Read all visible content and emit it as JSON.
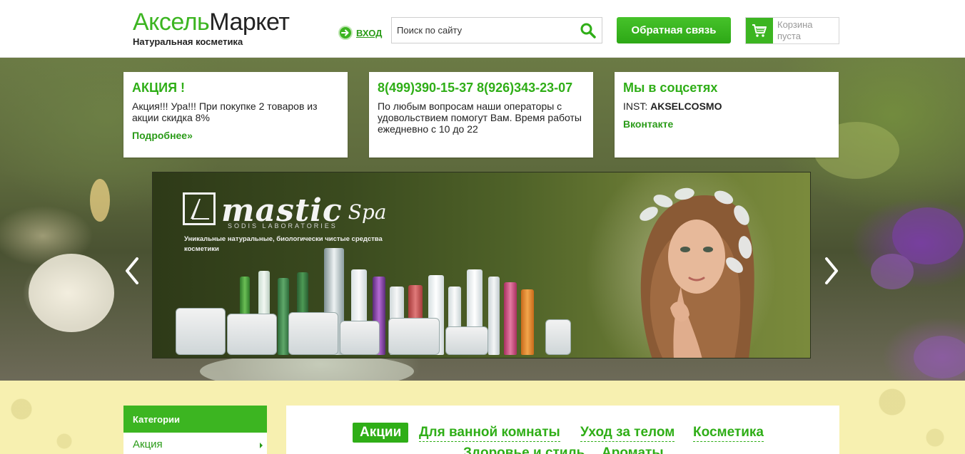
{
  "header": {
    "logo_part1": "Аксель",
    "logo_part2": "Маркет",
    "tagline": "Натуральная косметика",
    "login_label": "ВХОД",
    "search_placeholder": "Поиск по сайту",
    "feedback_label": "Обратная связь",
    "cart_label": "Корзина пуста"
  },
  "cards": {
    "promo": {
      "title": "АКЦИЯ !",
      "text": "Акция!!! Ура!!! При покупке 2 товаров из акции скидка 8%",
      "link": "Подробнее»"
    },
    "contacts": {
      "title": "8(499)390-15-37 8(926)343-23-07",
      "text": "По любым вопросам наши операторы с удовольствием помогут Вам. Время работы ежедневно с 10 до 22"
    },
    "social": {
      "title": "Мы в соцсетях",
      "inst_prefix": "INST:",
      "inst_name": "AKSELCOSMO",
      "vk_link": "Вконтакте"
    }
  },
  "banner": {
    "brand": "mastic",
    "brand_suffix": "Spa",
    "lab": "SODIS LABORATORIES",
    "tagline": "Уникальные натуральные, биологически чистые средства косметики"
  },
  "sidebar": {
    "heading": "Категории",
    "items": [
      {
        "label": "Акция"
      }
    ]
  },
  "tabs": [
    {
      "label": "Акции",
      "active": true
    },
    {
      "label": "Для ванной комнаты",
      "active": false
    },
    {
      "label": "Уход за телом",
      "active": false
    },
    {
      "label": "Косметика",
      "active": false
    },
    {
      "label": "Здоровье и стиль",
      "active": false
    },
    {
      "label": "Ароматы",
      "active": false
    }
  ],
  "colors": {
    "brand_green": "#3cb521",
    "link_green": "#2a9b18",
    "lower_bg": "#f7f0b0"
  }
}
